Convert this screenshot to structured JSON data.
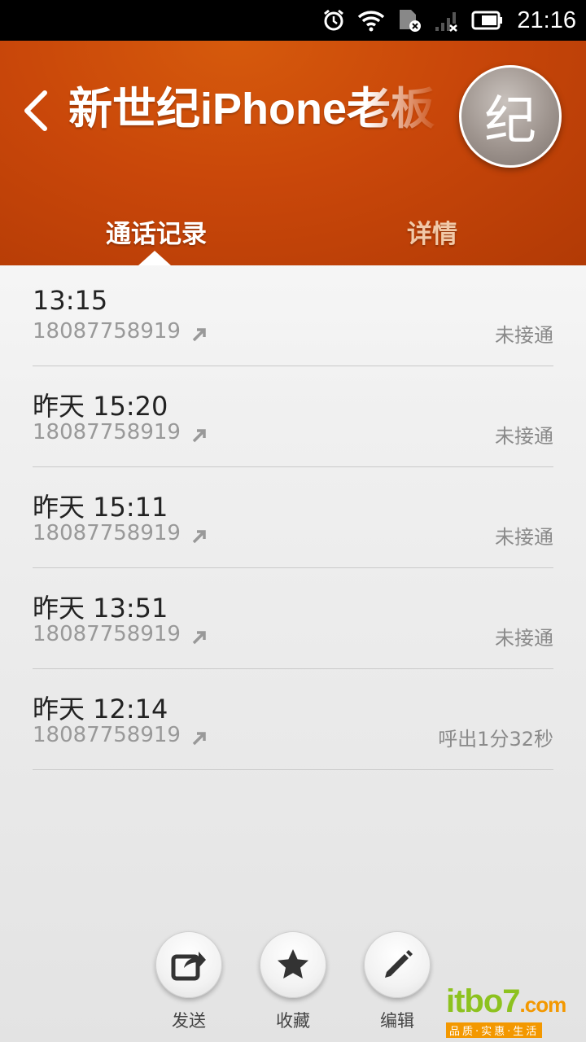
{
  "status_bar": {
    "time": "21:16",
    "icons": [
      "alarm-icon",
      "wifi-icon",
      "sim-disabled-icon",
      "signal-none-icon",
      "battery-icon"
    ]
  },
  "header": {
    "back_icon": "chevron-left-icon",
    "title": "新世纪iPhone老板",
    "avatar_text": "纪",
    "tabs": [
      {
        "label": "通话记录",
        "active": true
      },
      {
        "label": "详情",
        "active": false
      }
    ]
  },
  "calls": [
    {
      "time": "13:15",
      "number": "18087758919",
      "direction_icon": "outgoing-arrow-icon",
      "status": "未接通"
    },
    {
      "time": "昨天 15:20",
      "number": "18087758919",
      "direction_icon": "outgoing-arrow-icon",
      "status": "未接通"
    },
    {
      "time": "昨天 15:11",
      "number": "18087758919",
      "direction_icon": "outgoing-arrow-icon",
      "status": "未接通"
    },
    {
      "time": "昨天 13:51",
      "number": "18087758919",
      "direction_icon": "outgoing-arrow-icon",
      "status": "未接通"
    },
    {
      "time": "昨天 12:14",
      "number": "18087758919",
      "direction_icon": "outgoing-arrow-icon",
      "status": "呼出1分32秒"
    }
  ],
  "actions": [
    {
      "label": "发送",
      "icon": "share-icon"
    },
    {
      "label": "收藏",
      "icon": "star-icon"
    },
    {
      "label": "编辑",
      "icon": "pencil-icon"
    }
  ],
  "watermark": {
    "logo": "itbo7",
    "domain": ".com",
    "tagline": "品质·实惠·生活"
  },
  "colors": {
    "header_accent": "#c9470a",
    "tab_inactive": "#f1c9a8",
    "watermark_green": "#8dc21f",
    "watermark_orange": "#f39800"
  }
}
